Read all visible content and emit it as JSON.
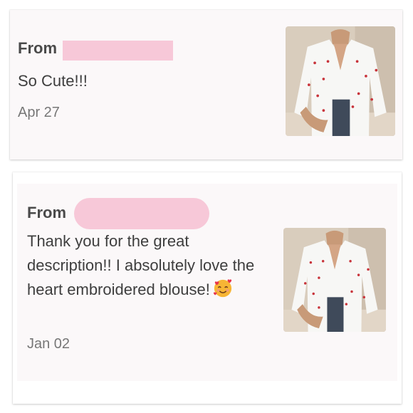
{
  "reviews": [
    {
      "from_label": "From",
      "message": "So Cute!!!",
      "date": "Apr 27",
      "thumbnail": "white-heart-embroidered-blouse-photo"
    },
    {
      "from_label": "From",
      "message": "Thank you for the great description!! I absolutely love the heart embroidered blouse!",
      "emoji": "smiling-face-with-hearts",
      "date": "Jan 02",
      "thumbnail": "white-heart-embroidered-blouse-photo"
    }
  ],
  "colors": {
    "card_bg": "#fbf8f9",
    "redaction": "#f7c8d8",
    "heart": "#c8333a"
  }
}
